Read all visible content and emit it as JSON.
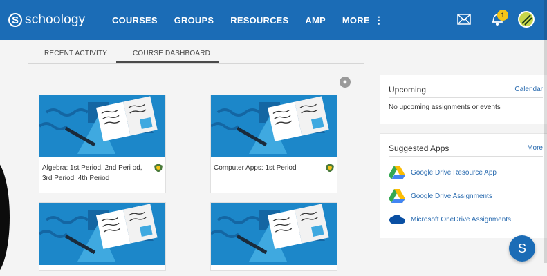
{
  "app": {
    "logo_mark": "S",
    "logo_text": "schoology"
  },
  "nav": {
    "items": [
      {
        "label": "COURSES"
      },
      {
        "label": "GROUPS"
      },
      {
        "label": "RESOURCES"
      },
      {
        "label": "AMP"
      },
      {
        "label": "MORE"
      }
    ],
    "more_icon": "kebab-icon"
  },
  "topbar": {
    "notification_count": "1",
    "icons": [
      "mail-icon",
      "bell-icon",
      "avatar"
    ]
  },
  "tabs": [
    {
      "label": "RECENT ACTIVITY",
      "active": false
    },
    {
      "label": "COURSE DASHBOARD",
      "active": true
    }
  ],
  "courses": [
    {
      "title": "Algebra: 1st Period, 2nd Peri od, 3rd Period, 4th Period"
    },
    {
      "title": "Computer Apps: 1st Period"
    },
    {
      "title": ""
    },
    {
      "title": ""
    }
  ],
  "upcoming": {
    "title": "Upcoming",
    "link": "Calendar",
    "empty_text": "No upcoming assignments or events"
  },
  "suggested_apps": {
    "title": "Suggested Apps",
    "link": "More",
    "apps": [
      {
        "label": "Google Drive Resource App",
        "icon": "google-drive-icon"
      },
      {
        "label": "Google Drive Assignments",
        "icon": "google-drive-icon"
      },
      {
        "label": "Microsoft OneDrive Assignments",
        "icon": "onedrive-icon"
      }
    ]
  },
  "chat": {
    "label": "S"
  },
  "colors": {
    "brand_blue": "#1b6cb6",
    "card_art_blue": "#1c87c9",
    "badge_yellow": "#f5c518"
  }
}
